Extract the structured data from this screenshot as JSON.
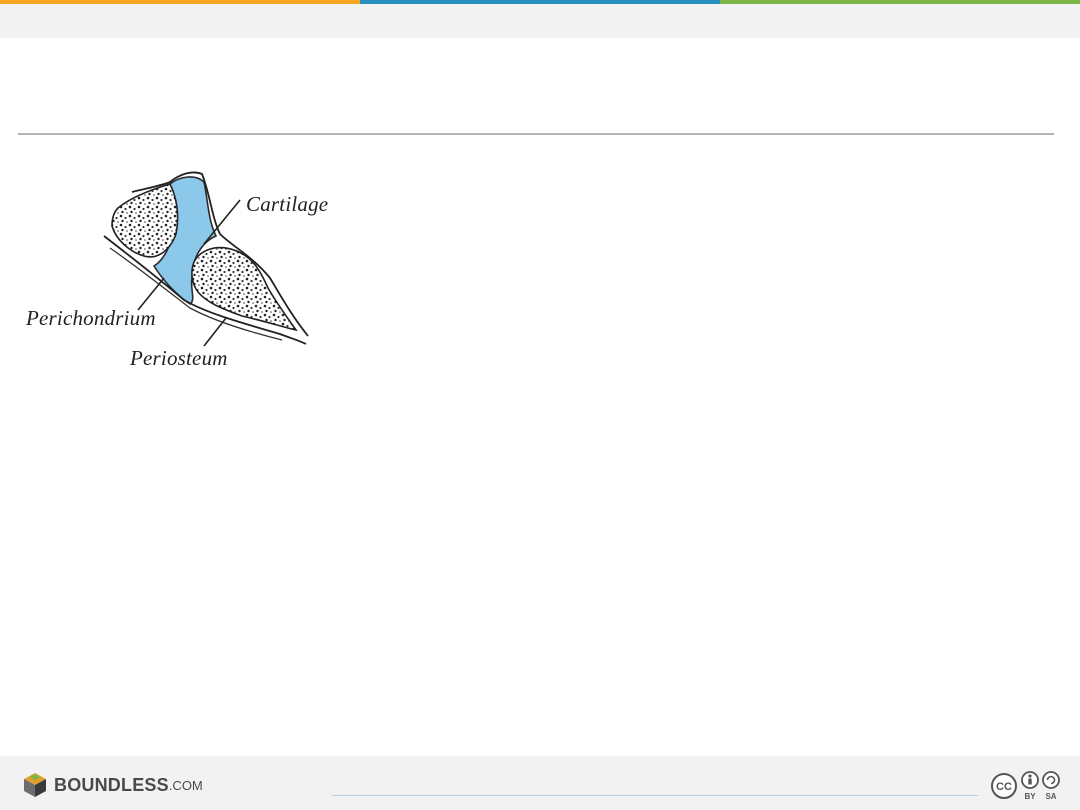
{
  "header": {
    "stripe_colors": [
      "#f5a623",
      "#2a8fbd",
      "#7ab648"
    ]
  },
  "figure": {
    "labels": {
      "cartilage": "Cartilage",
      "perichondrium": "Perichondrium",
      "periosteum": "Periosteum"
    },
    "cartilage_color": "#8cc8ea"
  },
  "footer": {
    "logo_text": "BOUNDLESS",
    "logo_suffix": ".COM",
    "license_badge": [
      "CC",
      "BY",
      "SA"
    ]
  }
}
